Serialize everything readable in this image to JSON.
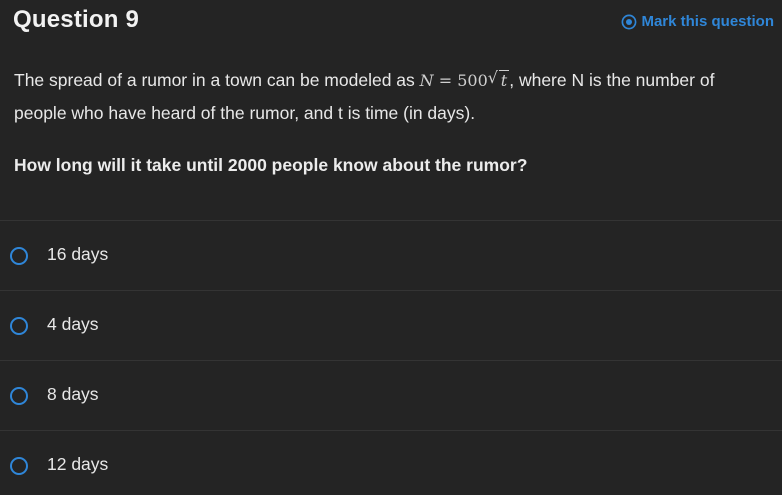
{
  "header": {
    "title": "Question 9",
    "mark_label": "Mark this question"
  },
  "question": {
    "text_before": "The spread of a rumor in a town can be modeled as ",
    "formula": {
      "lhs": "N",
      "eq": " = ",
      "coef": "500",
      "radicand": "t"
    },
    "text_after": ", where N is the number of people who have heard of the rumor, and t is time (in days).",
    "prompt": "How long will it take until 2000 people know about the rumor?"
  },
  "options": [
    {
      "label": "16 days"
    },
    {
      "label": "4 days"
    },
    {
      "label": "8 days"
    },
    {
      "label": "12 days"
    }
  ],
  "colors": {
    "background": "#242424",
    "accent": "#2f86d8",
    "divider": "#343434"
  },
  "icons": {
    "mark": "radio-target-icon",
    "option": "radio-empty-icon"
  }
}
